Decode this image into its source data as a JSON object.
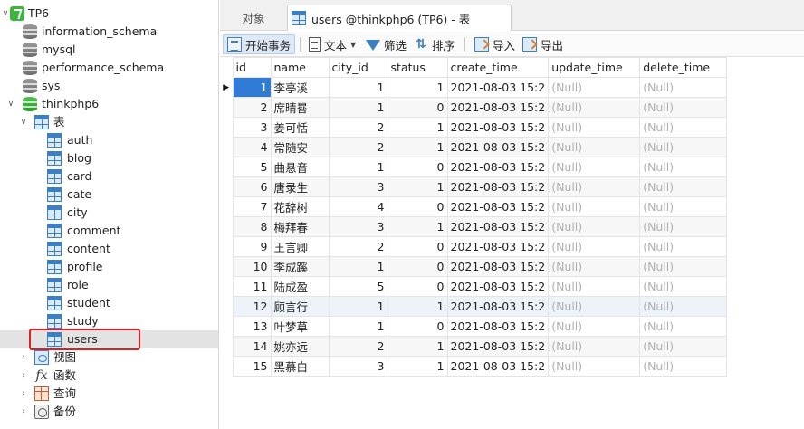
{
  "sidebar": {
    "connection": "TP6",
    "databases": [
      "information_schema",
      "mysql",
      "performance_schema",
      "sys",
      "thinkphp6"
    ],
    "tables_node": "表",
    "tables": [
      "auth",
      "blog",
      "card",
      "cate",
      "city",
      "comment",
      "content",
      "profile",
      "role",
      "student",
      "study",
      "users"
    ],
    "selected_table": "users",
    "other_nodes": [
      "视图",
      "函数",
      "查询",
      "备份"
    ]
  },
  "tabs": {
    "objects": "对象",
    "users": "users @thinkphp6 (TP6) - 表"
  },
  "toolbar": {
    "begin_transaction": "开始事务",
    "text": "文本",
    "filter": "筛选",
    "sort": "排序",
    "import": "导入",
    "export": "导出"
  },
  "grid": {
    "columns": [
      "id",
      "name",
      "city_id",
      "status",
      "create_time",
      "update_time",
      "delete_time"
    ],
    "rows": [
      [
        "1",
        "李亭溪",
        "1",
        "1",
        "2021-08-03 15:2",
        "(Null)",
        "(Null)"
      ],
      [
        "2",
        "席晴晷",
        "1",
        "0",
        "2021-08-03 15:2",
        "(Null)",
        "(Null)"
      ],
      [
        "3",
        "姜可恬",
        "2",
        "1",
        "2021-08-03 15:2",
        "(Null)",
        "(Null)"
      ],
      [
        "4",
        "常随安",
        "2",
        "1",
        "2021-08-03 15:2",
        "(Null)",
        "(Null)"
      ],
      [
        "5",
        "曲悬音",
        "1",
        "0",
        "2021-08-03 15:2",
        "(Null)",
        "(Null)"
      ],
      [
        "6",
        "唐录生",
        "3",
        "1",
        "2021-08-03 15:2",
        "(Null)",
        "(Null)"
      ],
      [
        "7",
        "花辞树",
        "4",
        "0",
        "2021-08-03 15:2",
        "(Null)",
        "(Null)"
      ],
      [
        "8",
        "梅拜春",
        "3",
        "1",
        "2021-08-03 15:2",
        "(Null)",
        "(Null)"
      ],
      [
        "9",
        "王言卿",
        "2",
        "0",
        "2021-08-03 15:2",
        "(Null)",
        "(Null)"
      ],
      [
        "10",
        "李成蹊",
        "1",
        "0",
        "2021-08-03 15:2",
        "(Null)",
        "(Null)"
      ],
      [
        "11",
        "陆成盈",
        "5",
        "0",
        "2021-08-03 15:2",
        "(Null)",
        "(Null)"
      ],
      [
        "12",
        "顾言行",
        "1",
        "1",
        "2021-08-03 15:2",
        "(Null)",
        "(Null)"
      ],
      [
        "13",
        "叶梦草",
        "1",
        "0",
        "2021-08-03 15:2",
        "(Null)",
        "(Null)"
      ],
      [
        "14",
        "姚亦远",
        "2",
        "1",
        "2021-08-03 15:2",
        "(Null)",
        "(Null)"
      ],
      [
        "15",
        "黑慕白",
        "3",
        "1",
        "2021-08-03 15:2",
        "(Null)",
        "(Null)"
      ]
    ]
  },
  "icons": {
    "connection": "connection-icon",
    "database": "database-icon",
    "table": "table-icon",
    "view": "view-icon",
    "function": "function-icon",
    "query": "query-icon",
    "backup": "backup-icon"
  },
  "colors": {
    "active_cell": "#2f7bd5",
    "highlight_box": "#e02020",
    "accent": "#3b7fc4"
  }
}
